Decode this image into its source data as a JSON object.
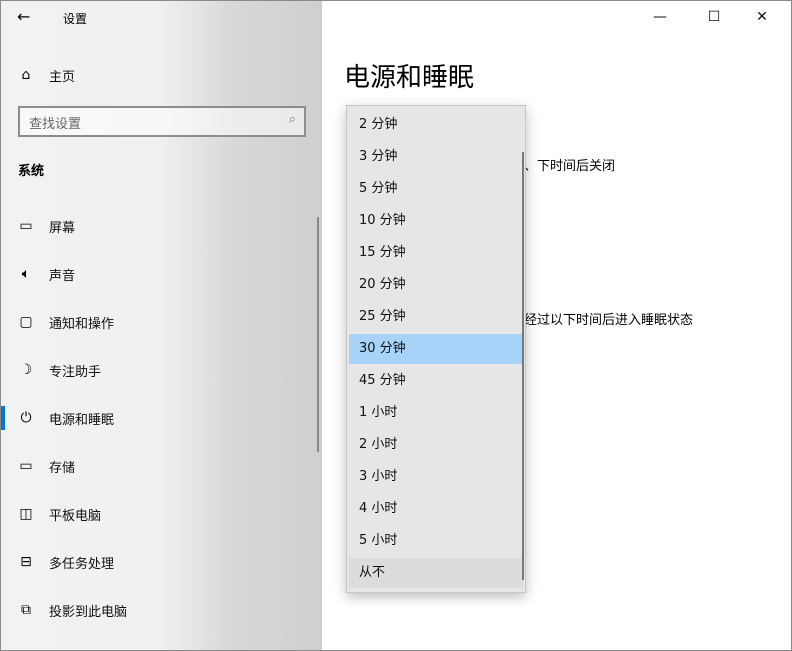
{
  "window": {
    "title": "设置",
    "back_icon": "back-arrow-icon",
    "minimize": "minimize-icon",
    "maximize": "maximize-icon",
    "close": "close-icon"
  },
  "sidebar": {
    "home": "主页",
    "search_placeholder": "查找设置",
    "section": "系统",
    "items": [
      {
        "label": "屏幕",
        "icon": "monitor-icon"
      },
      {
        "label": "声音",
        "icon": "speaker-icon"
      },
      {
        "label": "通知和操作",
        "icon": "notification-icon"
      },
      {
        "label": "专注助手",
        "icon": "moon-icon"
      },
      {
        "label": "电源和睡眠",
        "icon": "power-icon",
        "selected": true
      },
      {
        "label": "存储",
        "icon": "storage-icon"
      },
      {
        "label": "平板电脑",
        "icon": "tablet-icon"
      },
      {
        "label": "多任务处理",
        "icon": "multitask-icon"
      },
      {
        "label": "投影到此电脑",
        "icon": "project-icon"
      }
    ]
  },
  "main": {
    "title": "电源和睡眠",
    "screen_text_partial": "、下时间后关闭",
    "sleep_text_partial": "经过以下时间后进入睡眠状态"
  },
  "dropdown": {
    "selected": "30 分钟",
    "options": [
      "2 分钟",
      "3 分钟",
      "5 分钟",
      "10 分钟",
      "15 分钟",
      "20 分钟",
      "25 分钟",
      "30 分钟",
      "45 分钟",
      "1 小时",
      "2 小时",
      "3 小时",
      "4 小时",
      "5 小时",
      "从不"
    ]
  },
  "colors": {
    "accent": "#0078d7",
    "highlight": "#a6d3f7"
  }
}
